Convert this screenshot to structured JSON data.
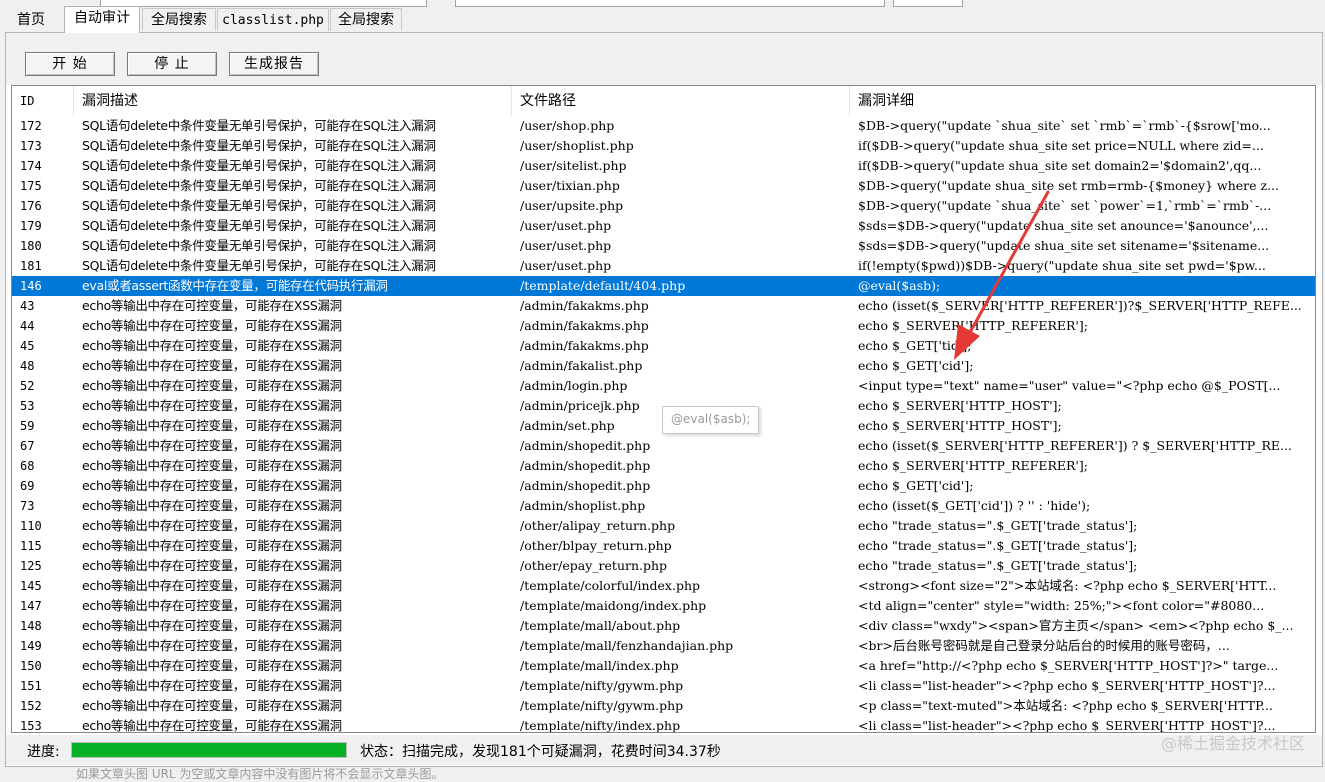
{
  "tabs": [
    {
      "label": "首页"
    },
    {
      "label": "自动审计"
    },
    {
      "label": "全局搜索"
    },
    {
      "label": "classlist.php"
    },
    {
      "label": "全局搜索"
    }
  ],
  "toolbar": {
    "start_label": "开 始",
    "stop_label": "停 止",
    "report_label": "生成报告"
  },
  "columns": {
    "id": "ID",
    "desc": "漏洞描述",
    "path": "文件路径",
    "detail": "漏洞详细"
  },
  "rows": [
    {
      "id": "172",
      "desc": "SQL语句delete中条件变量无单引号保护，可能存在SQL注入漏洞",
      "path": "/user/shop.php",
      "detail": "$DB->query(\"update `shua_site` set `rmb`=`rmb`-{$srow['mo..."
    },
    {
      "id": "173",
      "desc": "SQL语句delete中条件变量无单引号保护，可能存在SQL注入漏洞",
      "path": "/user/shoplist.php",
      "detail": "if($DB->query(\"update shua_site set price=NULL where zid=..."
    },
    {
      "id": "174",
      "desc": "SQL语句delete中条件变量无单引号保护，可能存在SQL注入漏洞",
      "path": "/user/sitelist.php",
      "detail": "if($DB->query(\"update shua_site set domain2='$domain2',qq..."
    },
    {
      "id": "175",
      "desc": "SQL语句delete中条件变量无单引号保护，可能存在SQL注入漏洞",
      "path": "/user/tixian.php",
      "detail": "$DB->query(\"update shua_site set rmb=rmb-{$money} where z..."
    },
    {
      "id": "176",
      "desc": "SQL语句delete中条件变量无单引号保护，可能存在SQL注入漏洞",
      "path": "/user/upsite.php",
      "detail": "$DB->query(\"update `shua_site` set `power`=1,`rmb`=`rmb`-..."
    },
    {
      "id": "179",
      "desc": "SQL语句delete中条件变量无单引号保护，可能存在SQL注入漏洞",
      "path": "/user/uset.php",
      "detail": "$sds=$DB->query(\"update shua_site set anounce='$anounce',..."
    },
    {
      "id": "180",
      "desc": "SQL语句delete中条件变量无单引号保护，可能存在SQL注入漏洞",
      "path": "/user/uset.php",
      "detail": "$sds=$DB->query(\"update shua_site set sitename='$sitename..."
    },
    {
      "id": "181",
      "desc": "SQL语句delete中条件变量无单引号保护，可能存在SQL注入漏洞",
      "path": "/user/uset.php",
      "detail": "if(!empty($pwd))$DB->query(\"update shua_site set pwd='$pw..."
    },
    {
      "id": "146",
      "desc": "eval或者assert函数中存在变量，可能存在代码执行漏洞",
      "path": "/template/default/404.php",
      "detail": "@eval($asb);"
    },
    {
      "id": "43",
      "desc": "echo等输出中存在可控变量，可能存在XSS漏洞",
      "path": "/admin/fakakms.php",
      "detail": "echo (isset($_SERVER['HTTP_REFERER'])?$_SERVER['HTTP_REFE..."
    },
    {
      "id": "44",
      "desc": "echo等输出中存在可控变量，可能存在XSS漏洞",
      "path": "/admin/fakakms.php",
      "detail": "echo $_SERVER['HTTP_REFERER'];"
    },
    {
      "id": "45",
      "desc": "echo等输出中存在可控变量，可能存在XSS漏洞",
      "path": "/admin/fakakms.php",
      "detail": "echo $_GET['tid'];"
    },
    {
      "id": "48",
      "desc": "echo等输出中存在可控变量，可能存在XSS漏洞",
      "path": "/admin/fakalist.php",
      "detail": "echo $_GET['cid'];"
    },
    {
      "id": "52",
      "desc": "echo等输出中存在可控变量，可能存在XSS漏洞",
      "path": "/admin/login.php",
      "detail": "<input type=\"text\" name=\"user\" value=\"<?php echo @$_POST[..."
    },
    {
      "id": "53",
      "desc": "echo等输出中存在可控变量，可能存在XSS漏洞",
      "path": "/admin/pricejk.php",
      "detail": "echo $_SERVER['HTTP_HOST'];"
    },
    {
      "id": "59",
      "desc": "echo等输出中存在可控变量，可能存在XSS漏洞",
      "path": "/admin/set.php",
      "detail": "echo $_SERVER['HTTP_HOST'];"
    },
    {
      "id": "67",
      "desc": "echo等输出中存在可控变量，可能存在XSS漏洞",
      "path": "/admin/shopedit.php",
      "detail": "echo (isset($_SERVER['HTTP_REFERER']) ? $_SERVER['HTTP_RE..."
    },
    {
      "id": "68",
      "desc": "echo等输出中存在可控变量，可能存在XSS漏洞",
      "path": "/admin/shopedit.php",
      "detail": "echo $_SERVER['HTTP_REFERER'];"
    },
    {
      "id": "69",
      "desc": "echo等输出中存在可控变量，可能存在XSS漏洞",
      "path": "/admin/shopedit.php",
      "detail": "echo $_GET['cid'];"
    },
    {
      "id": "73",
      "desc": "echo等输出中存在可控变量，可能存在XSS漏洞",
      "path": "/admin/shoplist.php",
      "detail": "echo (isset($_GET['cid']) ? '' : 'hide');"
    },
    {
      "id": "110",
      "desc": "echo等输出中存在可控变量，可能存在XSS漏洞",
      "path": "/other/alipay_return.php",
      "detail": "echo \"trade_status=\".$_GET['trade_status'];"
    },
    {
      "id": "115",
      "desc": "echo等输出中存在可控变量，可能存在XSS漏洞",
      "path": "/other/blpay_return.php",
      "detail": "echo \"trade_status=\".$_GET['trade_status'];"
    },
    {
      "id": "125",
      "desc": "echo等输出中存在可控变量，可能存在XSS漏洞",
      "path": "/other/epay_return.php",
      "detail": "echo \"trade_status=\".$_GET['trade_status'];"
    },
    {
      "id": "145",
      "desc": "echo等输出中存在可控变量，可能存在XSS漏洞",
      "path": "/template/colorful/index.php",
      "detail": "<strong><font size=\"2\">本站域名: <?php echo $_SERVER['HTT..."
    },
    {
      "id": "147",
      "desc": "echo等输出中存在可控变量，可能存在XSS漏洞",
      "path": "/template/maidong/index.php",
      "detail": "<td align=\"center\" style=\"width: 25%;\"><font color=\"#8080..."
    },
    {
      "id": "148",
      "desc": "echo等输出中存在可控变量，可能存在XSS漏洞",
      "path": "/template/mall/about.php",
      "detail": "<div class=\"wxdy\"><span>官方主页</span> <em><?php echo $_..."
    },
    {
      "id": "149",
      "desc": "echo等输出中存在可控变量，可能存在XSS漏洞",
      "path": "/template/mall/fenzhandajian.php",
      "detail": "<br>后台账号密码就是自己登录分站后台的时候用的账号密码，..."
    },
    {
      "id": "150",
      "desc": "echo等输出中存在可控变量，可能存在XSS漏洞",
      "path": "/template/mall/index.php",
      "detail": "<a href=\"http://<?php echo $_SERVER['HTTP_HOST']?>\" targe..."
    },
    {
      "id": "151",
      "desc": "echo等输出中存在可控变量，可能存在XSS漏洞",
      "path": "/template/nifty/gywm.php",
      "detail": "<li class=\"list-header\"><?php echo $_SERVER['HTTP_HOST']?..."
    },
    {
      "id": "152",
      "desc": "echo等输出中存在可控变量，可能存在XSS漏洞",
      "path": "/template/nifty/gywm.php",
      "detail": "<p class=\"text-muted\">本站域名: <?php echo $_SERVER['HTTP..."
    },
    {
      "id": "153",
      "desc": "echo等输出中存在可控变量，可能存在XSS漏洞",
      "path": "/template/nifty/index.php",
      "detail": "<li class=\"list-header\"><?php echo $_SERVER['HTTP_HOST']?..."
    }
  ],
  "selected_index": 8,
  "tooltip": "@eval($asb);",
  "status": {
    "progress_label": "进度:",
    "progress_value": 1.0,
    "text": "状态：扫描完成，发现181个可疑漏洞，花费时间34.37秒"
  },
  "watermark": "@稀土掘金技术社区",
  "below_text": "如果文章头图 URL 为空或文章内容中没有图片将不会显示文章头图。",
  "colors": {
    "selection": "#0078d7",
    "progress": "#06b025",
    "arrow": "#e53935"
  }
}
